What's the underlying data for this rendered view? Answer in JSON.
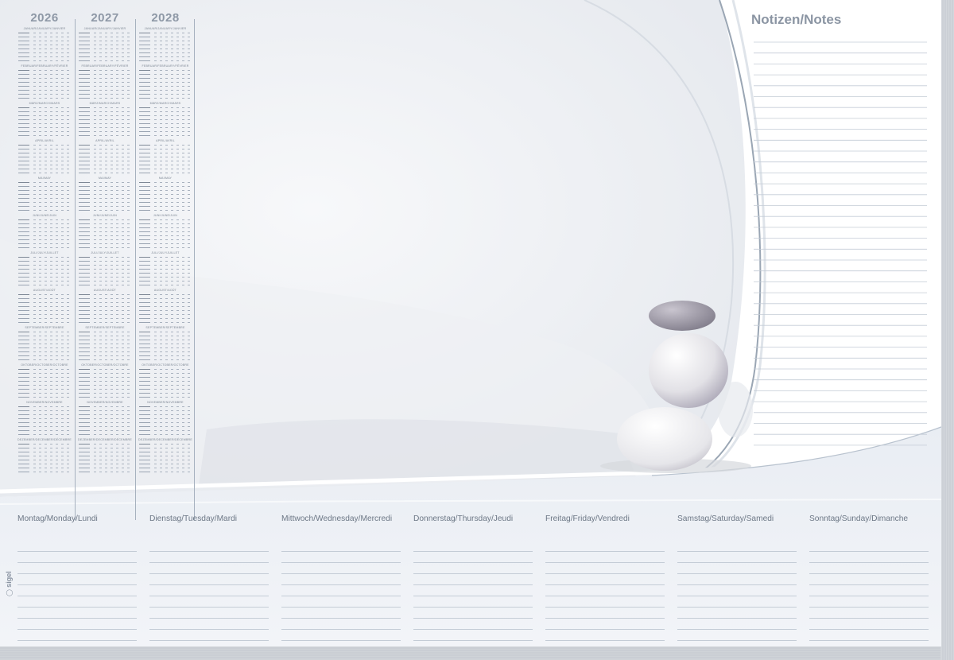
{
  "calendar": {
    "years": [
      "2026",
      "2027",
      "2028"
    ],
    "months": [
      "JANUAR/JANUARY/JANVIER",
      "FEBRUAR/FEBRUARY/FÉVRIER",
      "MÄRZ/MARCH/MARS",
      "APRIL/AVRIL",
      "MAI/MAY",
      "JUNI/JUNE/JUIN",
      "JULI/JULY/JUILLET",
      "AUGUST/AOÛT",
      "SEPTEMBER/SEPTEMBRE",
      "OKTOBER/OCTOBER/OCTOBRE",
      "NOVEMBER/NOVEMBRE",
      "DEZEMBER/DECEMBER/DÉCEMBRE"
    ]
  },
  "notes": {
    "title": "Notizen/Notes"
  },
  "week": {
    "days": [
      "Montag/Monday/Lundi",
      "Dienstag/Tuesday/Mardi",
      "Mittwoch/Wednesday/Mercredi",
      "Donnerstag/Thursday/Jeudi",
      "Freitag/Friday/Vendredi",
      "Samstag/Saturday/Samedi",
      "Sonntag/Sunday/Dimanche"
    ]
  },
  "brand": {
    "logo": "sigel"
  },
  "colors": {
    "accent": "#8b95a3",
    "line": "#c4ccd6",
    "wave": "#9aa6b4"
  }
}
